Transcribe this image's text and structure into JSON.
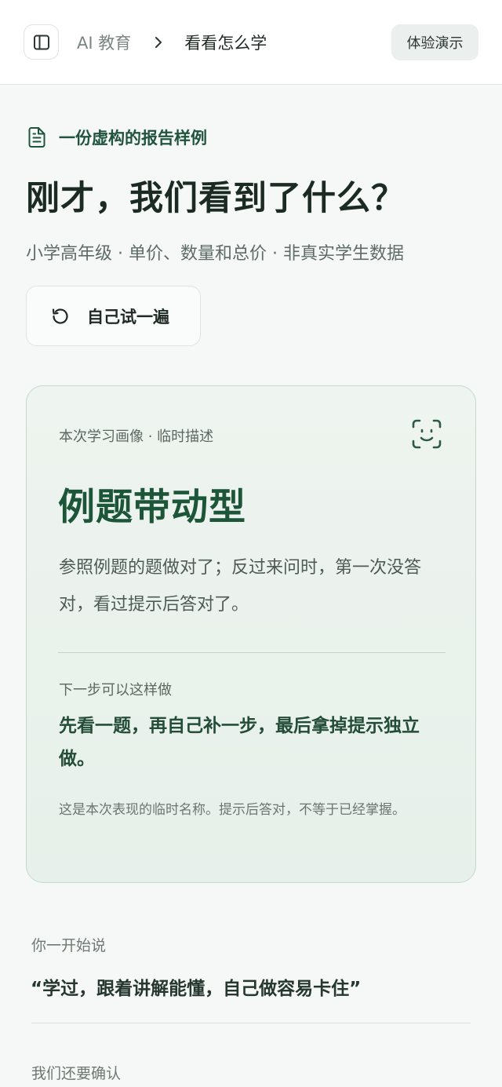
{
  "topbar": {
    "sidebar_toggle_icon": "sidebar-panel-icon",
    "breadcrumb": {
      "root": "AI 教育",
      "separator_icon": "chevron-right-icon",
      "current": "看看怎么学"
    },
    "demo_button": "体验演示"
  },
  "header": {
    "kicker_icon": "document-icon",
    "kicker": "一份虚构的报告样例",
    "title": "刚才，我们看到了什么？",
    "subtitle": "小学高年级 · 单价、数量和总价 · 非真实学生数据",
    "retry_icon": "rotate-ccw-icon",
    "retry_button": "自己试一遍"
  },
  "profile_card": {
    "label": "本次学习画像 · 临时描述",
    "icon": "face-scan-icon",
    "title": "例题带动型",
    "description": "参照例题的题做对了；反过来问时，第一次没答对，看过提示后答对了。",
    "next_step_label": "下一步可以这样做",
    "next_step": "先看一题，再自己补一步，最后拿掉提示独立做。",
    "note": "这是本次表现的临时名称。提示后答对，不等于已经掌握。"
  },
  "said_section": {
    "label": "你一开始说",
    "quote": "“学过，跟着讲解能懂，自己做容易卡住”"
  },
  "confirm_section": {
    "label": "我们还要确认"
  },
  "colors": {
    "accent_green": "#1c5538",
    "card_bg": "#eaf2ec",
    "card_border": "#c4d9cb",
    "page_bg": "#f5f8f6"
  }
}
